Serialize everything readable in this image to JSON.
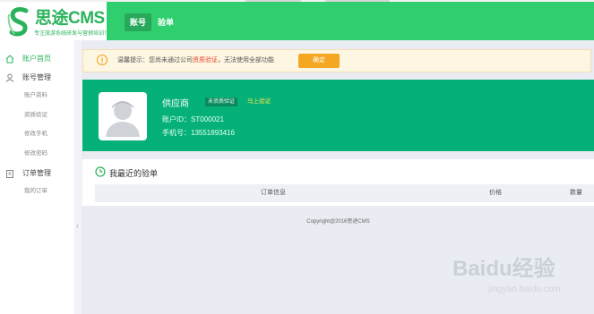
{
  "header": {
    "logo_name": "思途CMS",
    "logo_tagline": "专注旅游系统研发与营销培训！",
    "nav": [
      {
        "label": "账号",
        "active": true
      },
      {
        "label": "验单",
        "active": false
      }
    ]
  },
  "sidebar": {
    "home": "账户首页",
    "account_group": "账号管理",
    "account_items": [
      "账户资料",
      "资质验证",
      "修改手机",
      "修改密码"
    ],
    "order_group": "订单管理",
    "order_items": [
      "我的订单"
    ]
  },
  "notice": {
    "prefix": "温馨提示：您尚未通过公司",
    "highlight": "资质验证",
    "suffix": "，无法使用全部功能",
    "button": "确定"
  },
  "profile": {
    "name": "供应商",
    "status_badge": "未资质验证",
    "verify_link": "马上验证",
    "account_id": "账户ID：ST000021",
    "phone": "手机号：13551893416"
  },
  "orders": {
    "title": "我最近的验单",
    "columns": [
      "订单信息",
      "价格",
      "数量"
    ]
  },
  "footer": "Copyright@2016思途CMS",
  "watermark": {
    "main": "Baidu经验",
    "sub": "jingyan.baidu.com"
  },
  "colors": {
    "brand_green": "#2fcf6f",
    "banner_green": "#06b079",
    "warning": "#f5a623",
    "alert_red": "#e6452c"
  }
}
